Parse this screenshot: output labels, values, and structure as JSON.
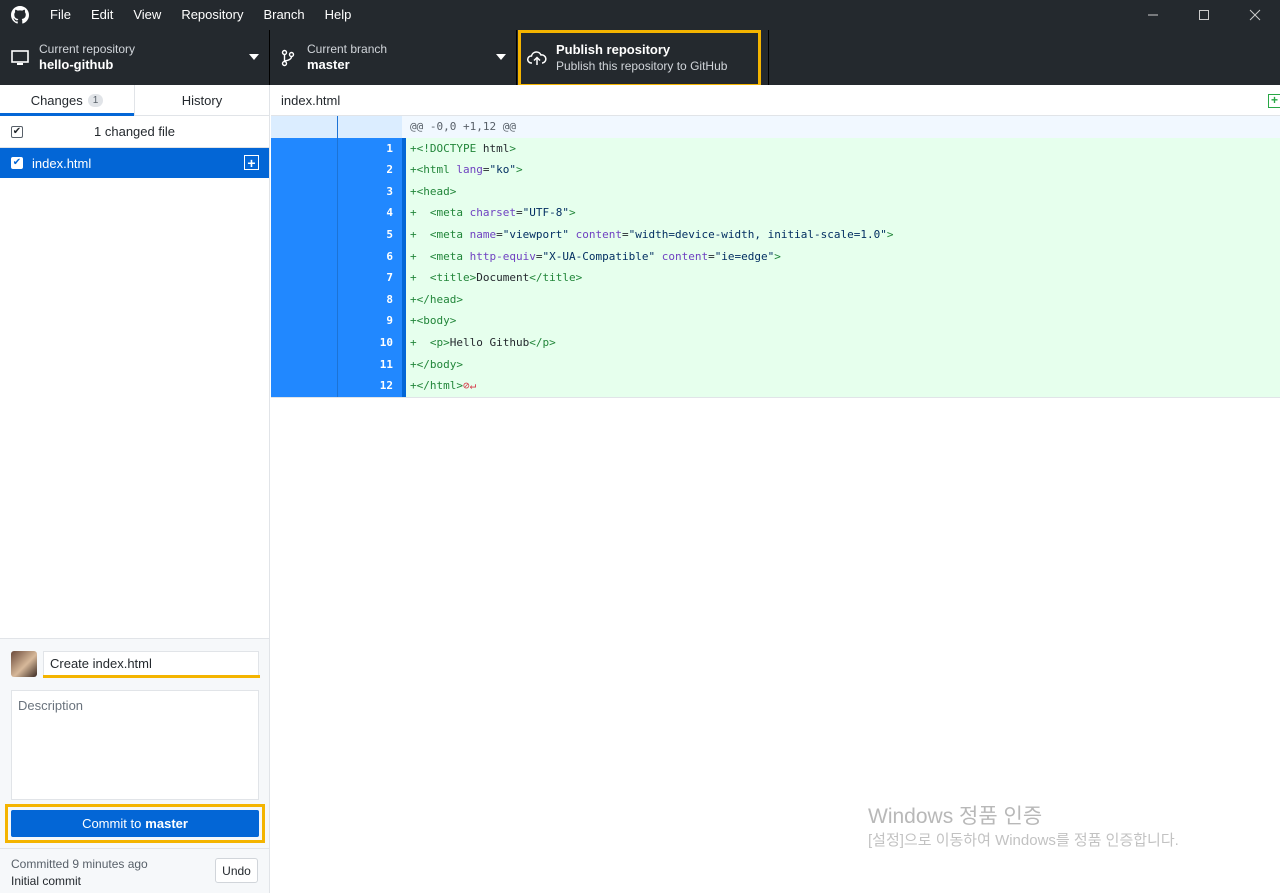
{
  "menu": [
    "File",
    "Edit",
    "View",
    "Repository",
    "Branch",
    "Help"
  ],
  "toolbar": {
    "repo_label": "Current repository",
    "repo_value": "hello-github",
    "branch_label": "Current branch",
    "branch_value": "master",
    "publish_title": "Publish repository",
    "publish_sub": "Publish this repository to GitHub"
  },
  "sidebar": {
    "tab_changes": "Changes",
    "tab_changes_count": "1",
    "tab_history": "History",
    "changed_count_text": "1 changed file",
    "files": [
      {
        "name": "index.html",
        "checked": true
      }
    ]
  },
  "commit": {
    "summary_value": "Create index.html",
    "description_placeholder": "Description",
    "button_prefix": "Commit to",
    "button_branch": "master"
  },
  "recent": {
    "time": "Committed 9 minutes ago",
    "message": "Initial commit",
    "undo_label": "Undo"
  },
  "diff": {
    "filename": "index.html",
    "hunk_header": "@@ -0,0 +1,12 @@",
    "lines": [
      {
        "num": "1",
        "code": "+<!DOCTYPE html>"
      },
      {
        "num": "2",
        "code": "+<html lang=\"ko\">"
      },
      {
        "num": "3",
        "code": "+<head>"
      },
      {
        "num": "4",
        "code": "+  <meta charset=\"UTF-8\">"
      },
      {
        "num": "5",
        "code": "+  <meta name=\"viewport\" content=\"width=device-width, initial-scale=1.0\">"
      },
      {
        "num": "6",
        "code": "+  <meta http-equiv=\"X-UA-Compatible\" content=\"ie=edge\">"
      },
      {
        "num": "7",
        "code": "+  <title>Document</title>"
      },
      {
        "num": "8",
        "code": "+</head>"
      },
      {
        "num": "9",
        "code": "+<body>"
      },
      {
        "num": "10",
        "code": "+  <p>Hello Github</p>"
      },
      {
        "num": "11",
        "code": "+</body>"
      },
      {
        "num": "12",
        "code": "+</html>"
      }
    ],
    "no_newline_marker": "⊘↵"
  },
  "watermark": {
    "title": "Windows 정품 인증",
    "subtitle": "[설정]으로 이동하여 Windows를 정품 인증합니다."
  },
  "colors": {
    "accent": "#0366d6",
    "highlight": "#f4b400",
    "toolbar_bg": "#24292e",
    "added_bg": "#e6ffed"
  },
  "icons": {
    "app": "github-logo-icon",
    "repo": "monitor-icon",
    "branch": "git-branch-icon",
    "publish": "cloud-upload-icon",
    "file_status": "file-added-icon"
  }
}
